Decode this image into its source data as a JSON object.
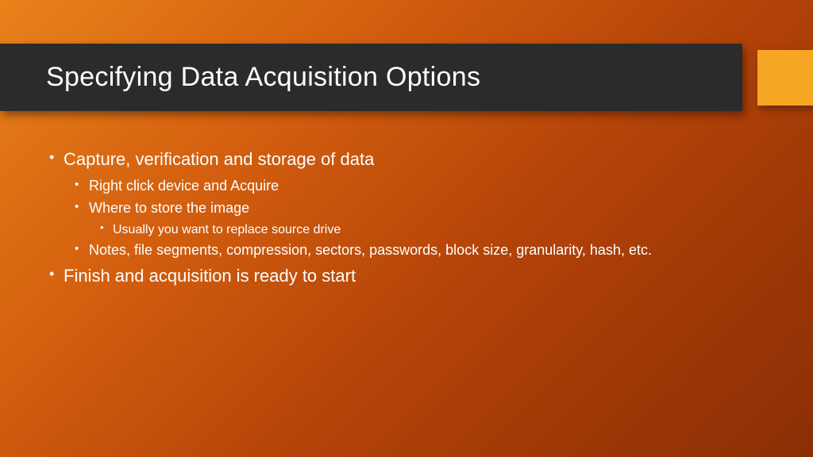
{
  "slide": {
    "title": "Specifying Data Acquisition Options",
    "bullets": {
      "b1": "Capture, verification and storage of data",
      "b1_1": "Right click device and Acquire",
      "b1_2": "Where to store the image",
      "b1_2_1": "Usually you want to replace source drive",
      "b1_3": "Notes, file segments, compression, sectors, passwords, block size, granularity, hash, etc.",
      "b2": "Finish and acquisition is ready to start"
    }
  },
  "colors": {
    "titleBar": "#2b2b2b",
    "accent": "#f5a623",
    "text": "#ffffff"
  }
}
